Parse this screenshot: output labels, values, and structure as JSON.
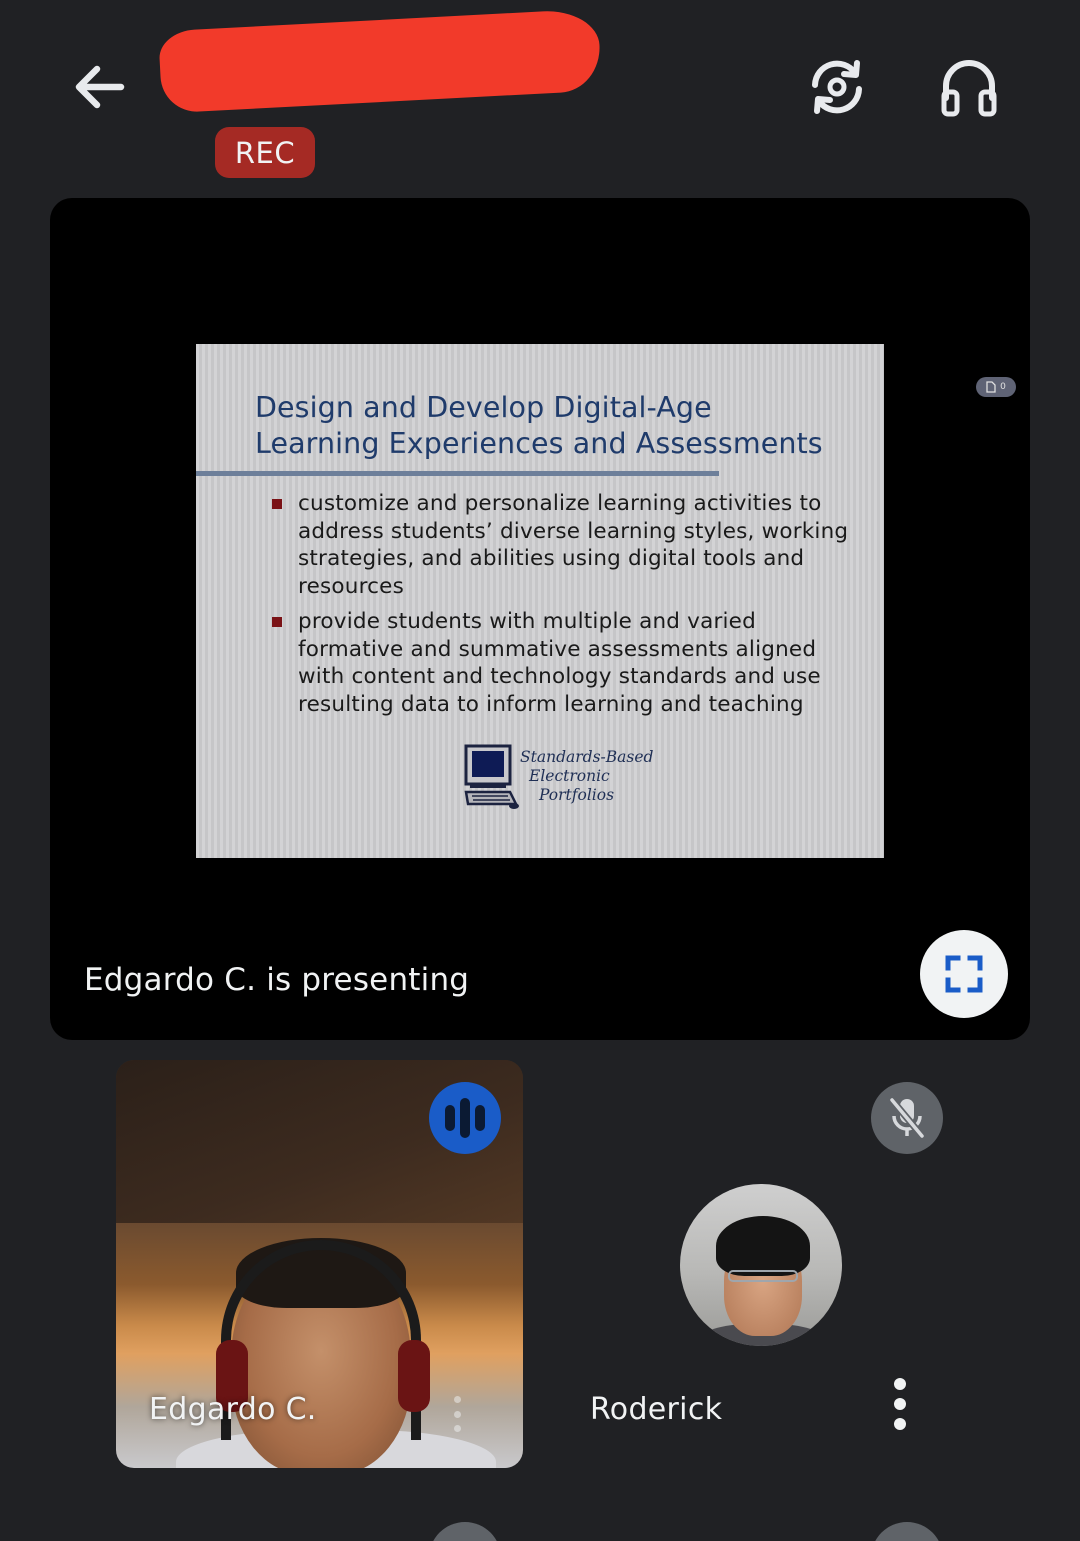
{
  "header": {
    "back_icon": "arrow-back-icon",
    "meeting_title": "",
    "rec_label": "REC",
    "switch_camera_icon": "switch-camera-icon",
    "audio_icon": "headphones-icon"
  },
  "presentation": {
    "presenter_label": "Edgardo C. is presenting",
    "fullscreen_icon": "fullscreen-icon",
    "page_indicator_icon": "document-icon",
    "page_indicator_value": "0",
    "slide": {
      "title_line1": "Design and Develop Digital-Age",
      "title_line2": "Learning Experiences and Assessments",
      "bullets": [
        "customize and personalize learning activities to address students’ diverse learning styles, working strategies, and abilities using digital tools and resources",
        "provide students with multiple and varied formative and summative assessments aligned with content and technology standards and use resulting data to inform learning and teaching"
      ],
      "logo_lines": [
        "Standards-Based",
        "Electronic",
        "Portfolios"
      ]
    }
  },
  "participants": [
    {
      "name": "Edgardo C.",
      "status_icon": "speaking-icon",
      "more_icon": "more-vert-icon"
    },
    {
      "name": "Roderick",
      "status_icon": "mic-off-icon",
      "more_icon": "more-vert-icon"
    }
  ],
  "colors": {
    "background": "#202124",
    "rec_badge": "#a52a24",
    "speaking_indicator": "#1a5cc8",
    "muted_indicator": "#5f6368",
    "title_redaction": "#f23a2a"
  }
}
